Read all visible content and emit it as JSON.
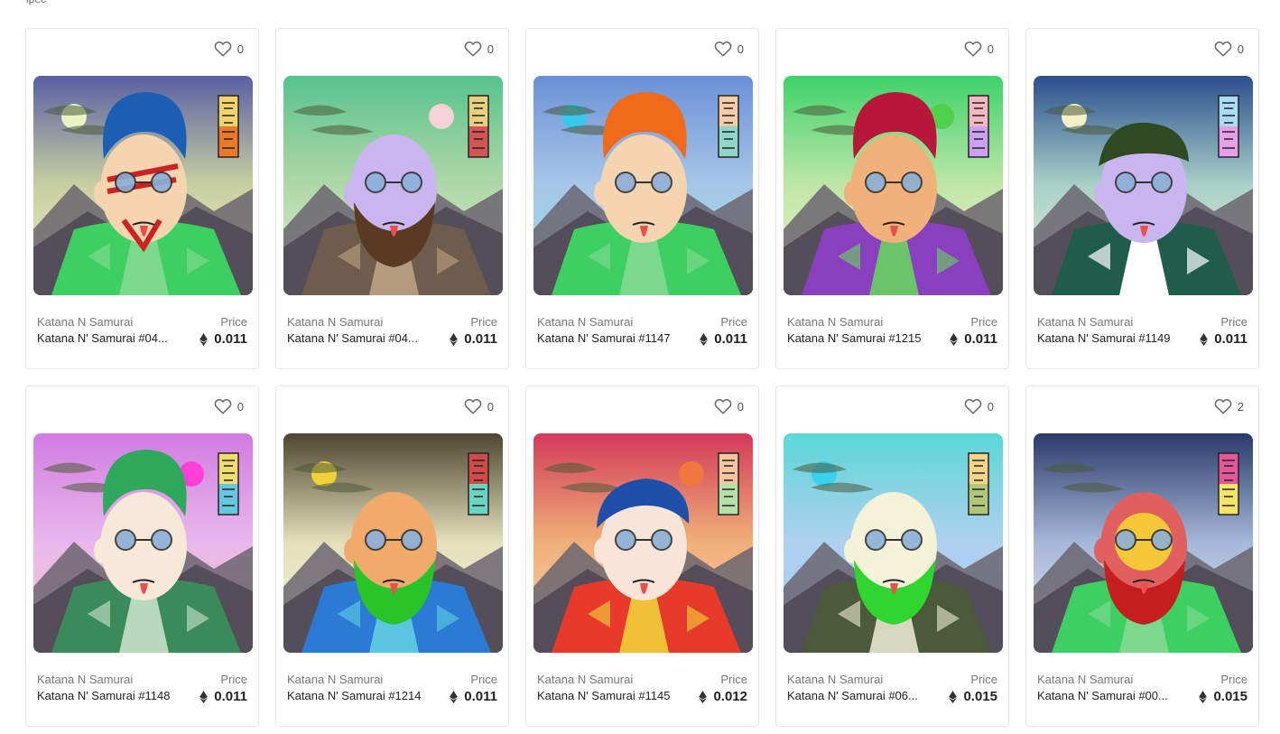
{
  "page": {
    "top_fragment": "ipec"
  },
  "labels": {
    "price": "Price"
  },
  "icons": {
    "like": "heart-outline-icon",
    "currency": "ethereum-icon"
  },
  "cards": [
    {
      "collection": "Katana N Samurai",
      "name": "Katana N' Samurai #04...",
      "likes": "0",
      "price": "0.011",
      "art": {
        "sky_top": "#5a5fa3",
        "sky_mid": "#c8d0a2",
        "sky_bottom": "#e9f2b8",
        "sun": "#e8f5c0",
        "hair": "#1b5fb5",
        "skin": "#f5d4b0",
        "robe": "#3ecf62",
        "robe2": "#7ad98c",
        "tag": [
          "#f3d46c",
          "#e87a2a"
        ],
        "face_paint": "#cc2222"
      }
    },
    {
      "collection": "Katana N Samurai",
      "name": "Katana N' Samurai #04...",
      "likes": "0",
      "price": "0.011",
      "art": {
        "sky_top": "#58c48c",
        "sky_mid": "#b0d7a8",
        "sky_bottom": "#e0f0d0",
        "sun": "#f5d2d8",
        "hair": "none",
        "skin": "#c9b6ee",
        "robe": "#6e5c4c",
        "robe2": "#b49a7e",
        "tag": [
          "#e7d07e",
          "#d15555"
        ],
        "beard": "#5a3a22"
      }
    },
    {
      "collection": "Katana N Samurai",
      "name": "Katana N' Samurai #1147",
      "likes": "0",
      "price": "0.011",
      "art": {
        "sky_top": "#6a91d6",
        "sky_mid": "#a8c6e8",
        "sky_bottom": "#8ee6e0",
        "sun": "#38c8f0",
        "hair": "#f06a1a",
        "skin": "#f5d4b0",
        "robe": "#3ecf62",
        "robe2": "#7ad98c",
        "tag": [
          "#f6cba6",
          "#8fd6c7"
        ]
      }
    },
    {
      "collection": "Katana N Samurai",
      "name": "Katana N' Samurai #1215",
      "likes": "0",
      "price": "0.011",
      "art": {
        "sky_top": "#3ed26a",
        "sky_mid": "#bfe7a6",
        "sky_bottom": "#f0f2d0",
        "sun": "#50d14a",
        "hair": "#b8163a",
        "skin": "#f0b27a",
        "robe": "#8a3fbf",
        "robe2": "#6bc36a",
        "tag": [
          "#f5b7c4",
          "#cda1f1"
        ]
      }
    },
    {
      "collection": "Katana N Samurai",
      "name": "Katana N' Samurai #1149",
      "likes": "0",
      "price": "0.011",
      "art": {
        "sky_top": "#2a4f8e",
        "sky_mid": "#aad0c8",
        "sky_bottom": "#e8f0d0",
        "sun": "#f4f0c8",
        "hair": "hat",
        "skin": "#c9b6ee",
        "robe": "#1f5c4a",
        "robe2": "#ffffff",
        "tag": [
          "#a8dcf7",
          "#e7a0e8"
        ]
      }
    },
    {
      "collection": "Katana N Samurai",
      "name": "Katana N' Samurai #1148",
      "likes": "0",
      "price": "0.011",
      "art": {
        "sky_top": "#d07ce0",
        "sky_mid": "#e9b8ec",
        "sky_bottom": "#f5c8c8",
        "sun": "#ff3fd8",
        "hair": "#2ea85a",
        "skin": "#f7e8d8",
        "robe": "#3a8a5a",
        "robe2": "#b8d9c0",
        "tag": [
          "#f0dc70",
          "#66c8e0"
        ]
      }
    },
    {
      "collection": "Katana N Samurai",
      "name": "Katana N' Samurai #1214",
      "likes": "0",
      "price": "0.011",
      "art": {
        "sky_top": "#4e4630",
        "sky_mid": "#e4e0bc",
        "sky_bottom": "#eef4d8",
        "sun": "#f0d238",
        "hair": "none",
        "skin": "#f0ab6a",
        "robe": "#2a7ad6",
        "robe2": "#5ac6e0",
        "tag": [
          "#d24a4a",
          "#6bd4c0"
        ],
        "beard": "#28c428"
      }
    },
    {
      "collection": "Katana N Samurai",
      "name": "Katana N' Samurai #1145",
      "likes": "0",
      "price": "0.012",
      "art": {
        "sky_top": "#d23a5a",
        "sky_mid": "#f0b078",
        "sky_bottom": "#f6d2b6",
        "sun": "#f07840",
        "hair": "bandana",
        "skin": "#f8e4d8",
        "robe": "#e83a2a",
        "robe2": "#f0c038",
        "tag": [
          "#f6c6a2",
          "#b5e0a8"
        ]
      }
    },
    {
      "collection": "Katana N Samurai",
      "name": "Katana N' Samurai #06...",
      "likes": "0",
      "price": "0.015",
      "art": {
        "sky_top": "#5ad8d8",
        "sky_mid": "#b0d0f0",
        "sky_bottom": "#9ccff0",
        "sun": "#3ad0f0",
        "hair": "none",
        "skin": "#f4f2d8",
        "robe": "#4a5a3a",
        "robe2": "#d8d8c0",
        "tag": [
          "#f6d48c",
          "#b0c878"
        ],
        "beard": "#2ed62e"
      }
    },
    {
      "collection": "Katana N Samurai",
      "name": "Katana N' Samurai #00...",
      "likes": "2",
      "price": "0.015",
      "art": {
        "sky_top": "#2a3a6a",
        "sky_mid": "#a6b8d8",
        "sky_bottom": "#dfe8f0",
        "sun": "none",
        "hair": "none",
        "skin": "#e06060",
        "robe": "#3ecf62",
        "robe2": "#7ad98c",
        "tag": [
          "#e8569a",
          "#f5e468"
        ],
        "beard": "#c41e1e",
        "mask": "#f5c838"
      }
    }
  ]
}
